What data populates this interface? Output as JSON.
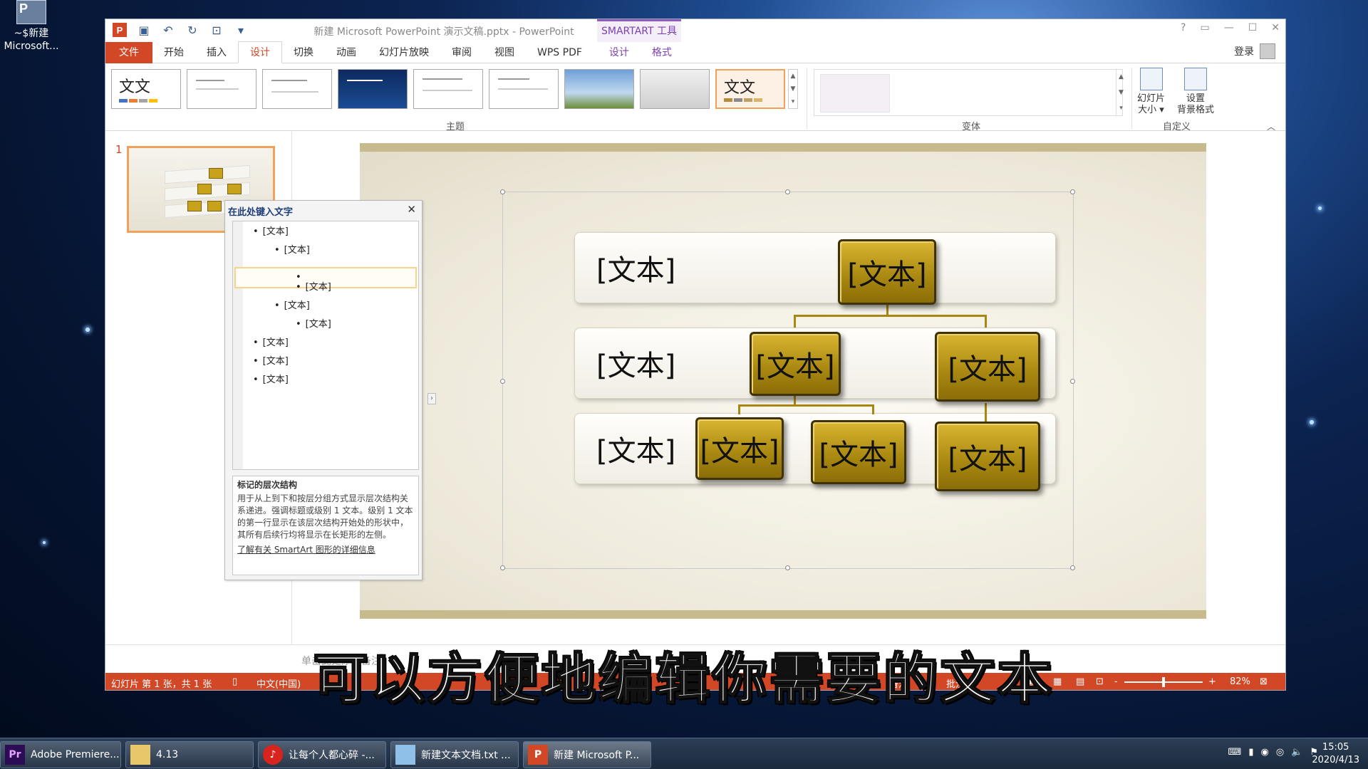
{
  "desktop": {
    "icon_label_1": "~$新建",
    "icon_label_2": "Microsoft..."
  },
  "window": {
    "title": "新建 Microsoft PowerPoint 演示文稿.pptx - PowerPoint",
    "smartart_tools": "SMARTART 工具",
    "controls": [
      "?",
      "▭",
      "—",
      "☐",
      "✕"
    ],
    "login": "登录"
  },
  "tabs": [
    "文件",
    "开始",
    "插入",
    "设计",
    "切换",
    "动画",
    "幻灯片放映",
    "审阅",
    "视图",
    "WPS PDF",
    "设计",
    "格式"
  ],
  "ribbon": {
    "theme_sample_text": "文文",
    "group_theme": "主题",
    "group_variant": "变体",
    "group_custom": "自定义",
    "btn_slide_size_1": "幻灯片",
    "btn_slide_size_2": "大小 ▾",
    "btn_bg_format_1": "设置",
    "btn_bg_format_2": "背景格式"
  },
  "slides_pane": {
    "slide_number": "1"
  },
  "smartart": {
    "row_labels": [
      "[文本]",
      "[文本]",
      "[文本]"
    ],
    "node_text": "[文本]"
  },
  "text_pane": {
    "title": "在此处键入文字",
    "close": "✕",
    "items": [
      "[文本]",
      "[文本]",
      "",
      "[文本]",
      "[文本]",
      "[文本]",
      "[文本]",
      "[文本]",
      "[文本]"
    ],
    "desc_heading": "标记的层次结构",
    "desc_body": "用于从上到下和按层分组方式显示层次结构关系递进。强调标题或级别 1 文本。级别 1 文本的第一行显示在该层次结构开始处的形状中，其所有后续行均将显示在长矩形的左侧。",
    "desc_link": "了解有关 SmartArt 图形的详细信息"
  },
  "notes_placeholder": "单击此处添加备注",
  "status": {
    "slide_info": "幻灯片 第 1 张，共 1 张",
    "language": "中文(中国)",
    "notes": "备注",
    "comments": "批注",
    "zoom_minus": "-",
    "zoom_plus": "+",
    "zoom": "82%",
    "zoom_level": 0.5
  },
  "subtitle": "可以方便地编辑你需要的文本",
  "taskbar": {
    "items": [
      "Adobe Premiere...",
      "4.13",
      "让每个人都心碎 -...",
      "新建文本文档.txt ...",
      "新建 Microsoft P..."
    ],
    "time": "15:05",
    "date": "2020/4/13"
  },
  "colors": {
    "accent": "#d24726",
    "smartart_purple": "#7b3fb2",
    "node_gold": "#a88710"
  }
}
